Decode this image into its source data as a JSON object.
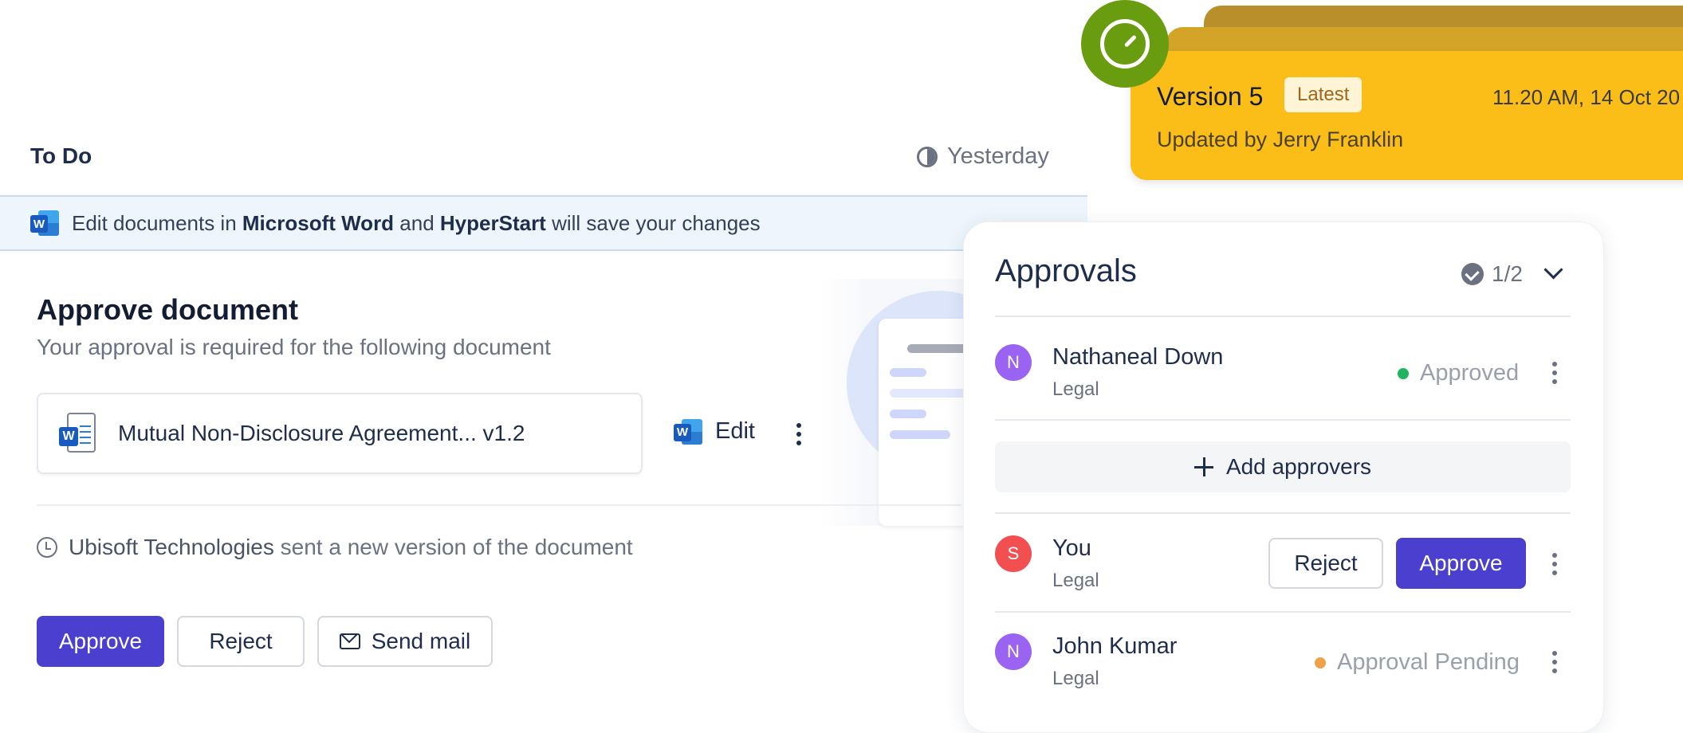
{
  "todo": {
    "title": "To Do",
    "time": "Yesterday"
  },
  "banner": {
    "prefix": "Edit documents in ",
    "app": "Microsoft Word",
    "middle": " and ",
    "product": "HyperStart",
    "suffix": " will save your changes"
  },
  "task": {
    "title": "Approve document",
    "subtitle": "Your approval is required for the following document",
    "document_name": "Mutual Non-Disclosure Agreement... v1.2",
    "edit_label": "Edit",
    "word_letter": "W",
    "history_company": "Ubisoft Technologies",
    "history_text": " sent a new version of the document",
    "actions": {
      "approve": "Approve",
      "reject": "Reject",
      "send_mail": "Send mail"
    }
  },
  "version": {
    "title": "Version 5",
    "badge": "Latest",
    "date": "11.20 AM, 14 Oct 20",
    "updated_by": "Updated by Jerry Franklin"
  },
  "approvals": {
    "title": "Approvals",
    "count": "1/2",
    "add_label": "Add approvers",
    "approvers": [
      {
        "initial": "N",
        "name": "Nathaneal Down",
        "role": "Legal",
        "status": "Approved",
        "status_color": "#22b35e",
        "avatar_color": "#9a63f2"
      },
      {
        "initial": "S",
        "name": "You",
        "role": "Legal",
        "reject": "Reject",
        "approve": "Approve",
        "avatar_color": "#f25050"
      },
      {
        "initial": "N",
        "name": "John Kumar",
        "role": "Legal",
        "status": "Approval Pending",
        "status_color": "#f0a24a",
        "avatar_color": "#9a63f2"
      }
    ]
  },
  "colors": {
    "primary": "#4a3fcf",
    "version_card": "#fbbd17",
    "timer_green": "#6a9c0f"
  }
}
